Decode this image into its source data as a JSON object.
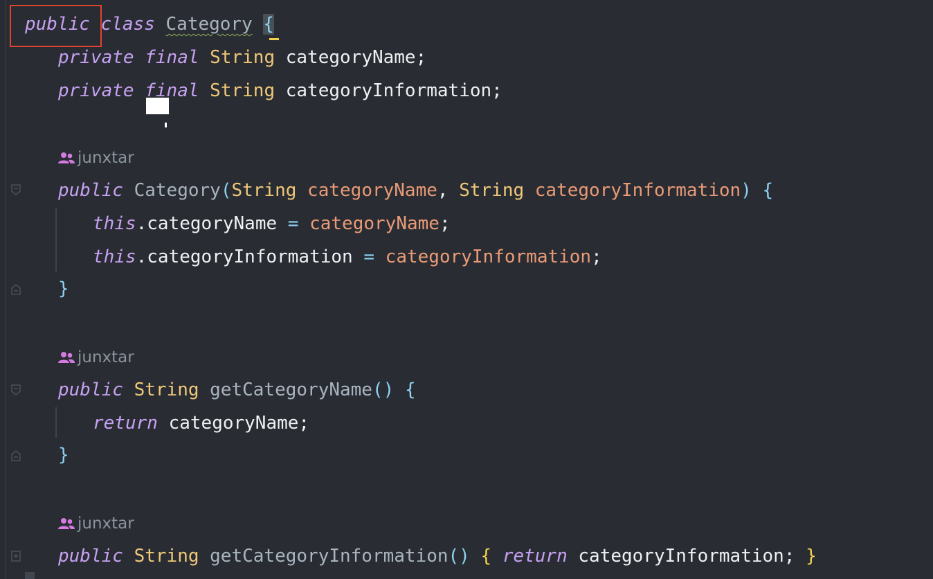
{
  "editor": {
    "code": {
      "class_decl": {
        "kw_public": "public",
        "kw_class": "class",
        "name": "Category",
        "open": "{"
      },
      "field1": {
        "kw_private": "private",
        "kw_final": "final",
        "type": "String",
        "name": "categoryName",
        "end": ";"
      },
      "field2": {
        "kw_private": "private",
        "kw_final": "final",
        "type": "String",
        "name": "categoryInformation",
        "end": ";"
      },
      "ctor": {
        "kw_public": "public",
        "name": "Category",
        "lparen": "(",
        "p1_type": "String",
        "p1_name": "categoryName",
        "comma": ",",
        "p2_type": "String",
        "p2_name": "categoryInformation",
        "rparen": ")",
        "open": "{",
        "line1": {
          "kw_this": "this",
          "dot": ".",
          "field": "categoryName",
          "eq": "=",
          "value": "categoryName",
          "end": ";"
        },
        "line2": {
          "kw_this": "this",
          "dot": ".",
          "field": "categoryInformation",
          "eq": "=",
          "value": "categoryInformation",
          "end": ";"
        },
        "close": "}"
      },
      "getter1": {
        "kw_public": "public",
        "type": "String",
        "name": "getCategoryName",
        "parens": "()",
        "open": "{",
        "kw_return": "return",
        "value": "categoryName",
        "end": ";",
        "close": "}"
      },
      "getter2": {
        "kw_public": "public",
        "type": "String",
        "name": "getCategoryInformation",
        "parens": "()",
        "open": "{",
        "kw_return": "return",
        "value": "categoryInformation",
        "end": ";",
        "close": "}"
      }
    },
    "authors": [
      "junxtar",
      "junxtar",
      "junxtar"
    ],
    "icons": {
      "author": "people-icon",
      "fold": "fold-marker-icon"
    }
  },
  "colors": {
    "background": "#292d33",
    "keyword": "#c7a1f2",
    "type": "#f0c878",
    "parameter": "#ea9a76",
    "field": "#eef0f2",
    "method": "#a9b4bf",
    "brace": "#8fd2f2",
    "highlight_box": "#e0442d"
  }
}
